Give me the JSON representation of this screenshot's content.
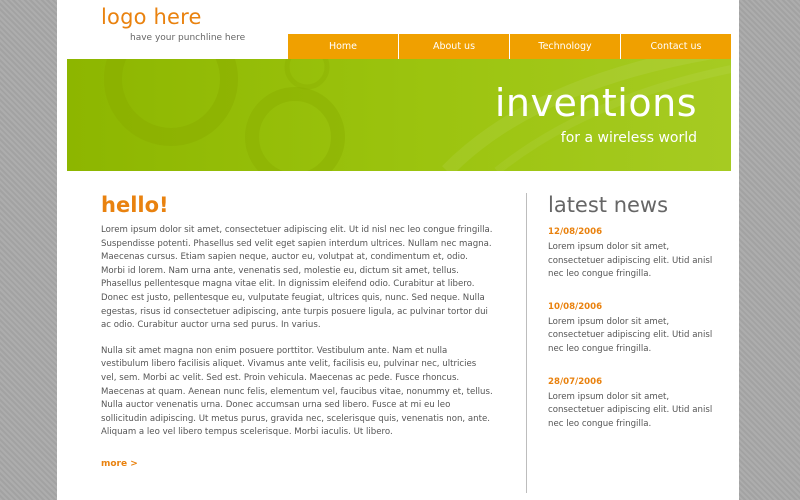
{
  "header": {
    "logo": "logo here",
    "tagline": "have your punchline here"
  },
  "nav": {
    "items": [
      {
        "label": "Home"
      },
      {
        "label": "About us"
      },
      {
        "label": "Technology"
      },
      {
        "label": "Contact us"
      }
    ]
  },
  "hero": {
    "title": "inventions",
    "subtitle": "for a wireless world"
  },
  "main": {
    "heading": "hello!",
    "paragraphs": [
      "Lorem ipsum dolor sit amet, consectetuer adipiscing elit. Ut id nisl nec leo congue fringilla. Suspendisse potenti. Phasellus sed velit eget sapien interdum ultrices. Nullam nec magna. Maecenas cursus. Etiam sapien neque, auctor eu, volutpat at, condimentum et, odio. Morbi id lorem. Nam urna ante, venenatis sed, molestie eu, dictum sit amet, tellus. Phasellus pellentesque magna vitae elit. In dignissim eleifend odio. Curabitur at libero. Donec est justo, pellentesque eu, vulputate feugiat, ultrices quis, nunc. Sed neque. Nulla egestas, risus id consectetuer adipiscing, ante turpis posuere ligula, ac pulvinar tortor dui ac odio. Curabitur auctor urna sed purus. In varius.",
      "Nulla sit amet magna non enim posuere porttitor. Vestibulum ante. Nam et nulla vestibulum libero facilisis aliquet. Vivamus ante velit, facilisis eu, pulvinar nec, ultricies vel, sem. Morbi ac velit. Sed est. Proin vehicula. Maecenas ac pede. Fusce rhoncus. Maecenas at quam. Aenean nunc felis, elementum vel, faucibus vitae, nonummy et, tellus. Nulla auctor venenatis urna. Donec accumsan urna sed libero. Fusce at mi eu leo sollicitudin adipiscing. Ut metus purus, gravida nec, scelerisque quis, venenatis non, ante. Aliquam a leo vel libero tempus scelerisque. Morbi iaculis. Ut libero."
    ],
    "more_label": "more >"
  },
  "sidebar": {
    "heading": "latest news",
    "items": [
      {
        "date": "12/08/2006",
        "text": "Lorem ipsum dolor sit amet, consectetuer adipiscing elit. Utid anisl nec leo congue fringilla."
      },
      {
        "date": "10/08/2006",
        "text": "Lorem ipsum dolor sit amet, consectetuer adipiscing elit. Utid anisl nec leo congue fringilla."
      },
      {
        "date": "28/07/2006",
        "text": "Lorem ipsum dolor sit amet, consectetuer adipiscing elit. Utid anisl nec leo congue fringilla."
      }
    ]
  },
  "colors": {
    "accent_orange": "#e9820f",
    "nav_orange": "#f0a000",
    "hero_green": "#9cc40f",
    "background_gray": "#a9a9a9"
  }
}
